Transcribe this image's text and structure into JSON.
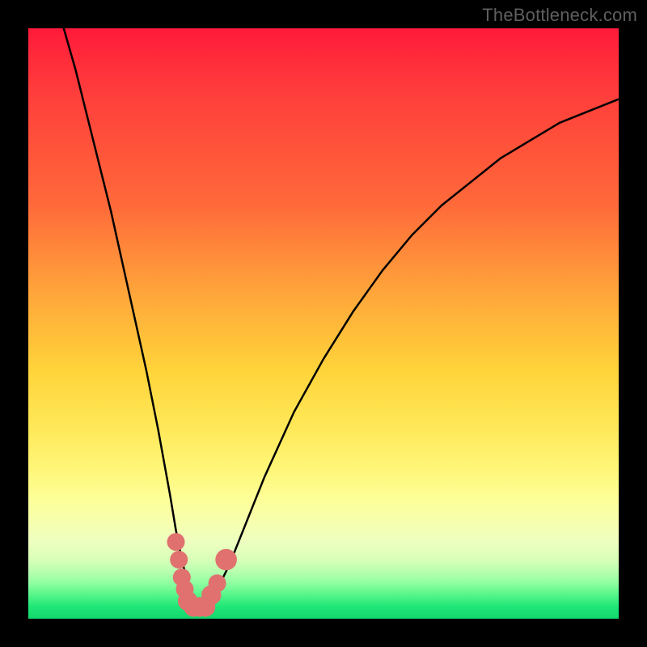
{
  "watermark": "TheBottleneck.com",
  "chart_data": {
    "type": "line",
    "title": "",
    "xlabel": "",
    "ylabel": "",
    "xlim": [
      0,
      100
    ],
    "ylim": [
      0,
      100
    ],
    "series": [
      {
        "name": "bottleneck-curve",
        "x": [
          6,
          8,
          10,
          12,
          14,
          16,
          18,
          20,
          22,
          24,
          25,
          26,
          27,
          28,
          29,
          30,
          31,
          32,
          34,
          36,
          40,
          45,
          50,
          55,
          60,
          65,
          70,
          75,
          80,
          85,
          90,
          95,
          100
        ],
        "y": [
          100,
          93,
          85,
          77,
          69,
          60,
          51,
          42,
          32,
          21,
          15,
          10,
          6,
          3,
          2,
          2,
          3,
          5,
          9,
          14,
          24,
          35,
          44,
          52,
          59,
          65,
          70,
          74,
          78,
          81,
          84,
          86,
          88
        ]
      }
    ],
    "markers": [
      {
        "name": "marker-left-1",
        "x": 25.0,
        "y": 13,
        "r": 1.2
      },
      {
        "name": "marker-left-2",
        "x": 25.5,
        "y": 10,
        "r": 1.2
      },
      {
        "name": "marker-left-3",
        "x": 26.0,
        "y": 7,
        "r": 1.2
      },
      {
        "name": "marker-left-4",
        "x": 26.5,
        "y": 5,
        "r": 1.2
      },
      {
        "name": "marker-bottom-1",
        "x": 27.0,
        "y": 3,
        "r": 1.4
      },
      {
        "name": "marker-bottom-2",
        "x": 28.0,
        "y": 2,
        "r": 1.4
      },
      {
        "name": "marker-bottom-3",
        "x": 29.0,
        "y": 2,
        "r": 1.4
      },
      {
        "name": "marker-bottom-4",
        "x": 30.0,
        "y": 2,
        "r": 1.4
      },
      {
        "name": "marker-right-1",
        "x": 31.0,
        "y": 4,
        "r": 1.4
      },
      {
        "name": "marker-right-2",
        "x": 32.0,
        "y": 6,
        "r": 1.2
      },
      {
        "name": "marker-right-3",
        "x": 33.5,
        "y": 10,
        "r": 1.6
      }
    ],
    "marker_color": "#e0716f",
    "curve_color": "#000000"
  }
}
